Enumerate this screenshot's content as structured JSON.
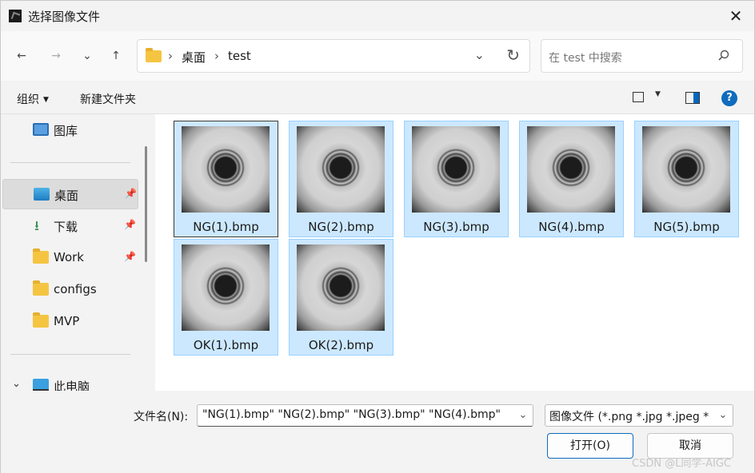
{
  "window": {
    "title": "选择图像文件",
    "close_label": "✕"
  },
  "nav": {
    "back": "←",
    "forward": "→",
    "recent": "⌄",
    "up": "↑",
    "breadcrumb": [
      "桌面",
      "test"
    ],
    "separator": "›",
    "dropdown": "⌄",
    "refresh": "↻",
    "search_placeholder": "在 test 中搜索"
  },
  "commands": {
    "organize": "组织",
    "organize_caret": "▼",
    "new_folder": "新建文件夹",
    "view_caret": "▼",
    "help": "?"
  },
  "sidebar": {
    "items": [
      {
        "label": "图库",
        "icon": "gallery-icon"
      },
      {
        "label": "桌面",
        "icon": "desktop-icon",
        "pinned": true,
        "selected": true
      },
      {
        "label": "下载",
        "icon": "download-icon",
        "pinned": true
      },
      {
        "label": "Work",
        "icon": "folder-icon",
        "pinned": true
      },
      {
        "label": "configs",
        "icon": "folder-icon"
      },
      {
        "label": "MVP",
        "icon": "folder-icon"
      },
      {
        "label": "此电脑",
        "icon": "pc-icon"
      }
    ],
    "pin_glyph": "📌",
    "download_glyph": "⭳",
    "expander": "⌄"
  },
  "files": [
    {
      "name": "NG(1).bmp"
    },
    {
      "name": "NG(2).bmp"
    },
    {
      "name": "NG(3).bmp"
    },
    {
      "name": "NG(4).bmp"
    },
    {
      "name": "NG(5).bmp"
    },
    {
      "name": "OK(1).bmp"
    },
    {
      "name": "OK(2).bmp"
    }
  ],
  "footer": {
    "filename_label": "文件名(N):",
    "filename_value": "\"NG(1).bmp\" \"NG(2).bmp\" \"NG(3).bmp\" \"NG(4).bmp\"",
    "filetype_value": "图像文件 (*.png *.jpg *.jpeg *",
    "dropdown": "⌄",
    "open_label": "打开(O)",
    "cancel_label": "取消",
    "watermark": "CSDN @L同学-AIGC"
  },
  "colors": {
    "selection": "#cce8ff",
    "selection_border": "#99d1ff",
    "accent": "#0f6cbd"
  }
}
